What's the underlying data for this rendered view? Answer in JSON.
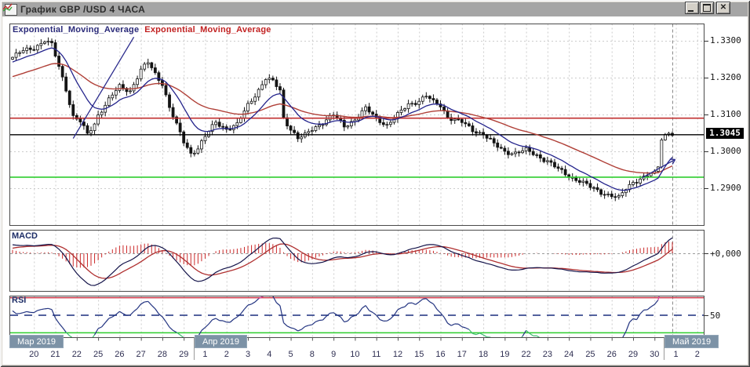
{
  "window": {
    "title": "График GBP /USD  4 ЧАСА",
    "controls": {
      "minimize": "minimize",
      "maximize": "maximize",
      "close": "close"
    }
  },
  "indicators": {
    "ema_fast_label": "Exponential_Moving_Average",
    "ema_slow_label": "Exponential_Moving_Average",
    "macd_label": "MACD",
    "rsi_label": "RSI"
  },
  "axes": {
    "price_labels": [
      "1.3300",
      "1.3200",
      "1.3100",
      "1.3000",
      "1.2900"
    ],
    "current_price": {
      "text": "1.3045",
      "value": 1.3045
    },
    "macd_zero_label": "+0,000",
    "rsi_mid_label": "50",
    "day_labels": [
      "20",
      "21",
      "22",
      "25",
      "26",
      "27",
      "28",
      "29",
      "1",
      "2",
      "3",
      "4",
      "5",
      "8",
      "9",
      "10",
      "11",
      "12",
      "15",
      "16",
      "17",
      "18",
      "19",
      "22",
      "23",
      "24",
      "25",
      "26",
      "29",
      "30",
      "1",
      "2"
    ],
    "months": [
      {
        "label": "Мар 2019"
      },
      {
        "label": "Апр 2019"
      },
      {
        "label": "Май 2019"
      }
    ]
  },
  "chart_data": {
    "type": "candlestick",
    "symbol": "GBP/USD",
    "timeframe": "4 hours",
    "bars_per_day": 6,
    "total_bars": 186,
    "y_axis": {
      "ticks": [
        1.33,
        1.32,
        1.31,
        1.3,
        1.29
      ],
      "visible_range": [
        1.28,
        1.3305
      ]
    },
    "close_path_anchors": [
      [
        0,
        1.3255
      ],
      [
        3,
        1.3272
      ],
      [
        6,
        1.3282
      ],
      [
        9,
        1.33
      ],
      [
        11,
        1.3288
      ],
      [
        13,
        1.323
      ],
      [
        15,
        1.317
      ],
      [
        17,
        1.3095
      ],
      [
        19,
        1.308
      ],
      [
        21,
        1.3045
      ],
      [
        23,
        1.3075
      ],
      [
        24,
        1.31
      ],
      [
        27,
        1.314
      ],
      [
        30,
        1.3175
      ],
      [
        33,
        1.3165
      ],
      [
        36,
        1.322
      ],
      [
        38,
        1.324
      ],
      [
        40,
        1.321
      ],
      [
        42,
        1.3185
      ],
      [
        44,
        1.312
      ],
      [
        46,
        1.307
      ],
      [
        48,
        1.3025
      ],
      [
        50,
        1.2995
      ],
      [
        52,
        1.301
      ],
      [
        54,
        1.304
      ],
      [
        57,
        1.3078
      ],
      [
        60,
        1.3062
      ],
      [
        63,
        1.3072
      ],
      [
        66,
        1.3125
      ],
      [
        69,
        1.3168
      ],
      [
        71,
        1.3198
      ],
      [
        73,
        1.3188
      ],
      [
        75,
        1.3165
      ],
      [
        76,
        1.309
      ],
      [
        78,
        1.3062
      ],
      [
        80,
        1.3035
      ],
      [
        82,
        1.3042
      ],
      [
        84,
        1.306
      ],
      [
        87,
        1.308
      ],
      [
        90,
        1.3098
      ],
      [
        93,
        1.3068
      ],
      [
        96,
        1.3088
      ],
      [
        99,
        1.3115
      ],
      [
        102,
        1.309
      ],
      [
        105,
        1.3072
      ],
      [
        108,
        1.3098
      ],
      [
        111,
        1.3128
      ],
      [
        114,
        1.3138
      ],
      [
        116,
        1.315
      ],
      [
        118,
        1.3132
      ],
      [
        120,
        1.3125
      ],
      [
        122,
        1.3095
      ],
      [
        124,
        1.3085
      ],
      [
        126,
        1.3078
      ],
      [
        129,
        1.3058
      ],
      [
        132,
        1.3048
      ],
      [
        135,
        1.3018
      ],
      [
        138,
        1.3
      ],
      [
        141,
        1.2996
      ],
      [
        144,
        1.3002
      ],
      [
        147,
        1.299
      ],
      [
        150,
        1.2974
      ],
      [
        153,
        1.295
      ],
      [
        156,
        1.2934
      ],
      [
        159,
        1.292
      ],
      [
        162,
        1.2902
      ],
      [
        165,
        1.289
      ],
      [
        168,
        1.288
      ],
      [
        170,
        1.2872
      ],
      [
        172,
        1.2898
      ],
      [
        174,
        1.2918
      ],
      [
        177,
        1.293
      ],
      [
        180,
        1.2944
      ],
      [
        181,
        1.2958
      ],
      [
        182,
        1.3032
      ],
      [
        183,
        1.3046
      ],
      [
        184,
        1.305
      ],
      [
        185,
        1.3045
      ]
    ],
    "levels": {
      "resistance_red": 1.309,
      "current_price_black": 1.3045,
      "support_green": 1.293
    },
    "overlays": {
      "ema_fast_period": 12,
      "ema_slow_period": 40
    },
    "trendlines": [
      {
        "from_bar": 17,
        "from_price": 1.3035,
        "to_bar": 34,
        "to_price": 1.331,
        "arrow": false
      },
      {
        "from_bar": 176.5,
        "from_price": 1.2928,
        "to_bar": 185.8,
        "to_price": 1.2978,
        "arrow": true
      }
    ],
    "macd": {
      "fast": 12,
      "slow": 26,
      "signal": 9,
      "zero_label": "+0,000"
    },
    "rsi": {
      "period": 14,
      "levels": [
        70,
        50,
        30
      ],
      "mid_label": "50"
    }
  },
  "colors": {
    "candle_up": "#ffffff",
    "candle_down": "#141414",
    "candle_stroke": "#141414",
    "ema_fast": "#24248c",
    "ema_slow": "#b04038",
    "hline_red": "#c03030",
    "hline_black": "#000000",
    "hline_green": "#2ece2e",
    "macd_line": "#14144a",
    "macd_signal": "#b03030",
    "macd_hist": "#cc2a2a",
    "rsi_line": "#223380",
    "rsi_over": "#d0409d",
    "rsi_under": "#3dbb6e",
    "rsi_70": "#cc3344",
    "rsi_50": "#1b2f7e",
    "rsi_30": "#2ece2e",
    "grid": "#cccccc",
    "panel_border": "#4a4a4a",
    "month_box": "#7c92a6",
    "trendline": "#2a2a8c"
  }
}
